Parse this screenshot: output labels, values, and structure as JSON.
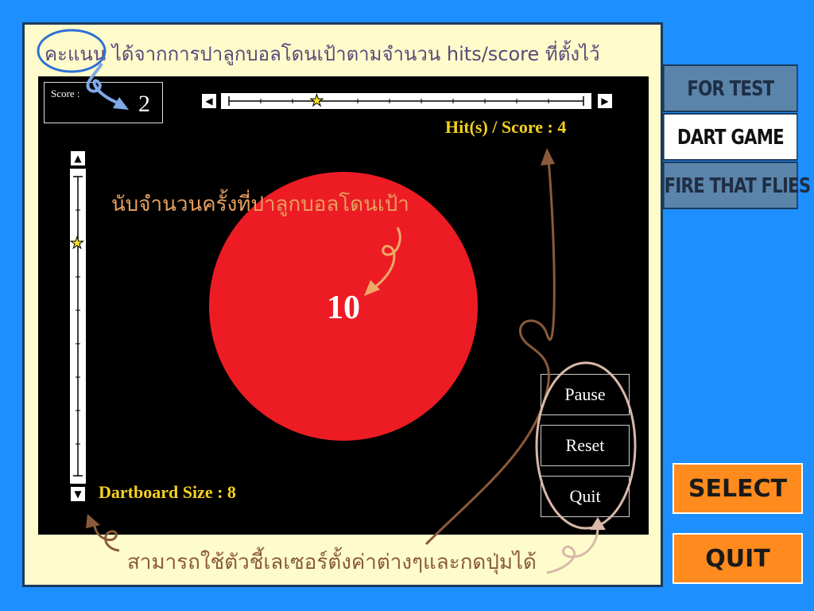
{
  "notes": {
    "top": "คะแนน ได้จากการปาลูกบอลโดนเป้าตามจำนวน hits/score ที่ตั้งไว้",
    "count": "นับจำนวนครั้งที่ปาลูกบอลโดนเป้า",
    "bottom": "สามารถใช้ตัวชี้เลเซอร์ตั้งค่าต่างๆและกดปุ่มได้"
  },
  "score": {
    "label": "Score :",
    "value": "2"
  },
  "hits": {
    "label": "Hit(s) / Score :",
    "value": "4",
    "slider_level": 0.25
  },
  "dartboard": {
    "label": "Dartboard Size :",
    "value": "8",
    "slider_level": 0.78
  },
  "target": {
    "count": "10",
    "color": "#ed1c24"
  },
  "game_buttons": {
    "pause": "Pause",
    "reset": "Reset",
    "quit": "Quit"
  },
  "side_menu": {
    "items": [
      {
        "label": "FOR TEST",
        "active": false
      },
      {
        "label": "DART GAME",
        "active": true
      },
      {
        "label": "FIRE THAT FLIES",
        "active": false
      }
    ]
  },
  "actions": {
    "select": "SELECT",
    "quit": "QUIT"
  },
  "colors": {
    "background": "#1e8fff",
    "panel": "#fffccc",
    "accent": "#f5d020",
    "action": "#ff8a1e",
    "menu_inactive": "#5b84aa"
  }
}
